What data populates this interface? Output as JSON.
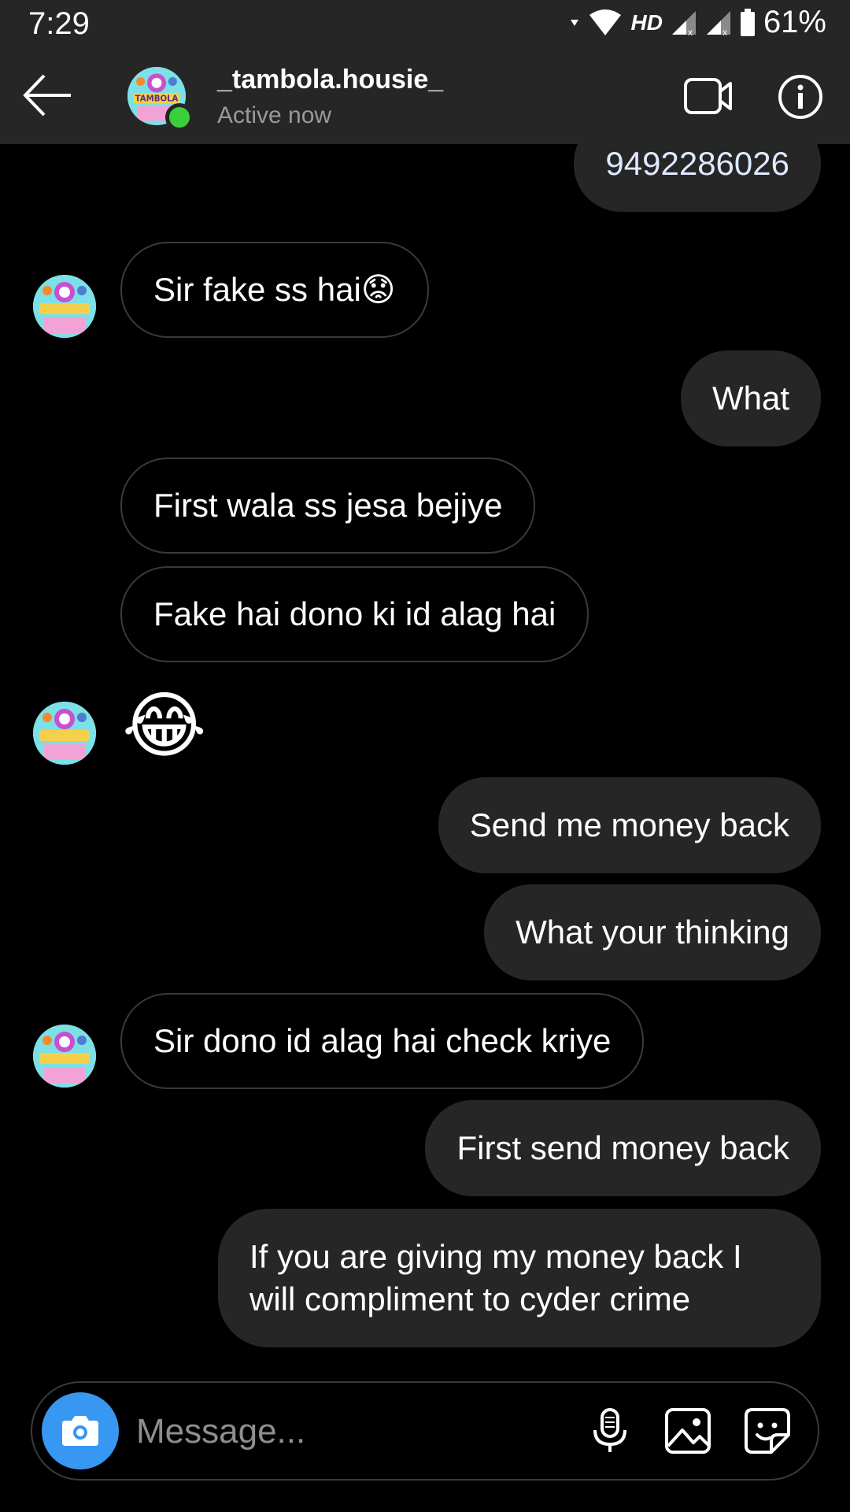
{
  "status_bar": {
    "time": "7:29",
    "network_label": "HD",
    "battery": "61%"
  },
  "header": {
    "username": "_tambola.housie_",
    "status": "Active now"
  },
  "messages": [
    {
      "direction": "out",
      "text": "9492286026"
    },
    {
      "direction": "in",
      "text": "Sir fake ss hai😟"
    },
    {
      "direction": "out",
      "text": "What"
    },
    {
      "direction": "in",
      "text": "First wala ss jesa bejiye"
    },
    {
      "direction": "in",
      "text": "Fake hai dono ki id alag hai"
    },
    {
      "direction": "in",
      "text": "😂"
    },
    {
      "direction": "out",
      "text": "Send me money back"
    },
    {
      "direction": "out",
      "text": "What your thinking"
    },
    {
      "direction": "in",
      "text": "Sir dono id alag hai check kriye"
    },
    {
      "direction": "out",
      "text": "First send money back"
    },
    {
      "direction": "out",
      "text": "If you are giving my money back I will compliment to cyder crime"
    }
  ],
  "composer": {
    "placeholder": "Message..."
  },
  "avatar": {
    "logo_text": "TAMBOLA"
  },
  "colors": {
    "accent": "#3897f0",
    "online": "#3ccf3c",
    "bubble_out": "#262626",
    "bubble_in_border": "#3a3a3a"
  },
  "icons": {
    "back": "arrow-left-icon",
    "video": "video-camera-icon",
    "info": "info-icon",
    "camera": "camera-icon",
    "mic": "microphone-icon",
    "gallery": "image-icon",
    "sticker": "sticker-icon"
  }
}
